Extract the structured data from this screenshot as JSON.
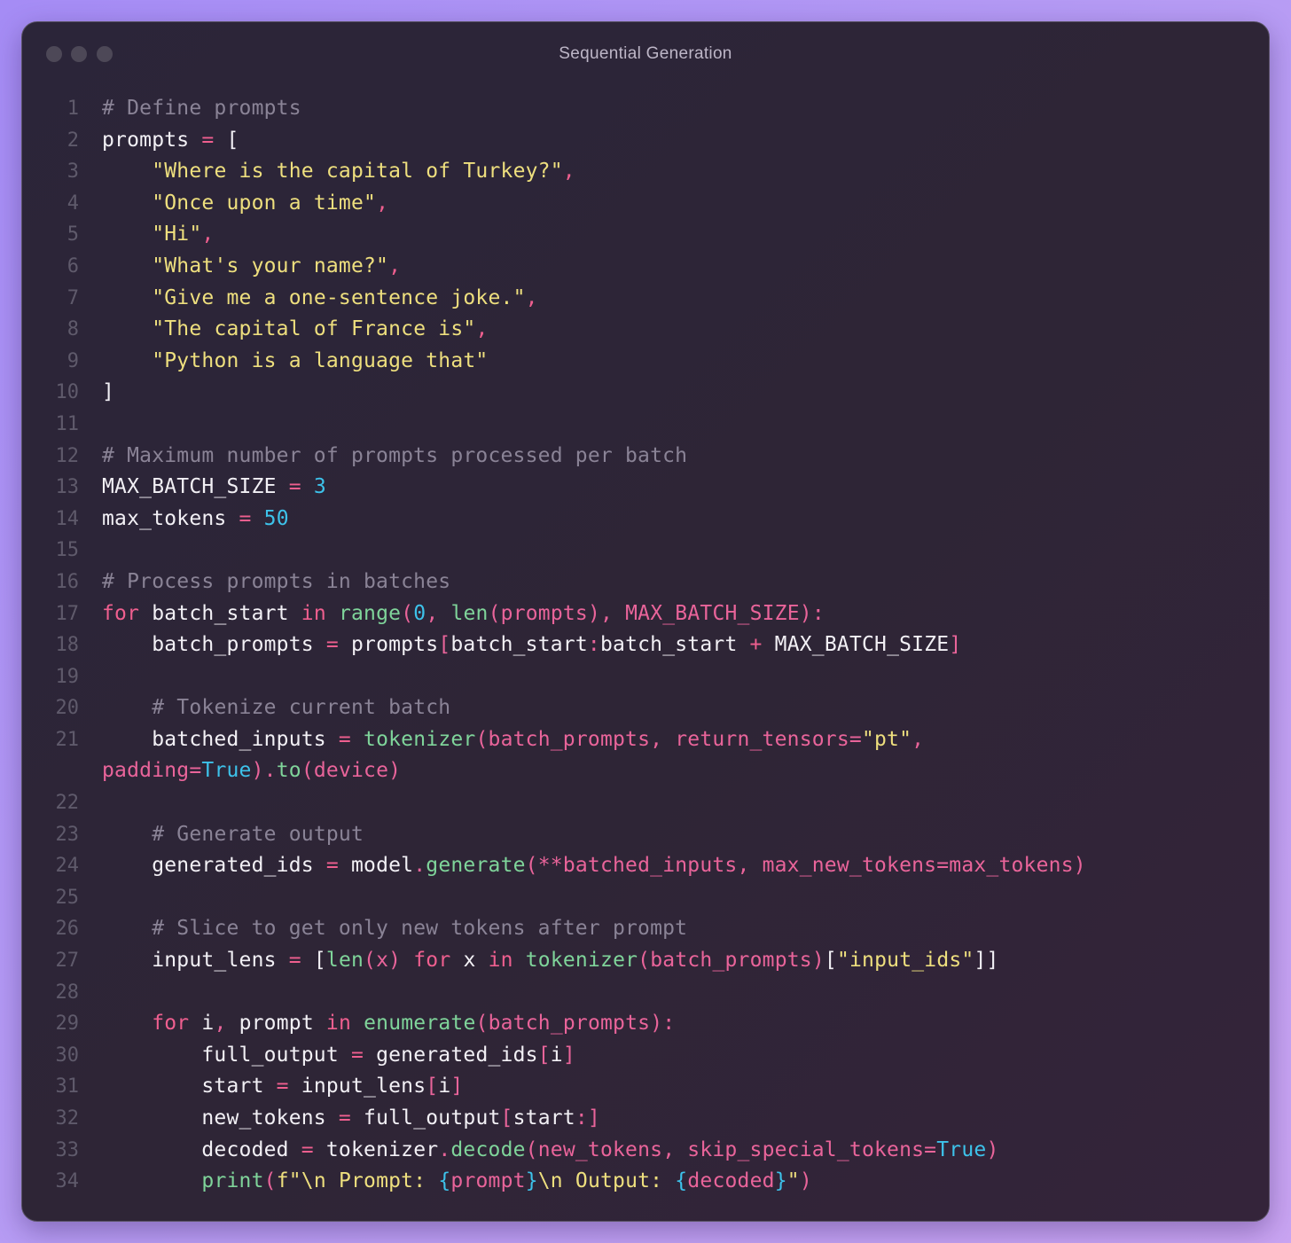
{
  "window": {
    "title": "Sequential Generation"
  },
  "code_lines": [
    {
      "n": "1",
      "t": [
        [
          "c",
          "# Define prompts"
        ]
      ]
    },
    {
      "n": "2",
      "t": [
        [
          "v",
          "prompts "
        ],
        [
          "k",
          "="
        ],
        [
          "v",
          " ["
        ]
      ]
    },
    {
      "n": "3",
      "t": [
        [
          "v",
          "    "
        ],
        [
          "s",
          "\"Where is the capital of Turkey?\""
        ],
        [
          "k",
          ","
        ]
      ]
    },
    {
      "n": "4",
      "t": [
        [
          "v",
          "    "
        ],
        [
          "s",
          "\"Once upon a time\""
        ],
        [
          "k",
          ","
        ]
      ]
    },
    {
      "n": "5",
      "t": [
        [
          "v",
          "    "
        ],
        [
          "s",
          "\"Hi\""
        ],
        [
          "k",
          ","
        ]
      ]
    },
    {
      "n": "6",
      "t": [
        [
          "v",
          "    "
        ],
        [
          "s",
          "\"What's your name?\""
        ],
        [
          "k",
          ","
        ]
      ]
    },
    {
      "n": "7",
      "t": [
        [
          "v",
          "    "
        ],
        [
          "s",
          "\"Give me a one-sentence joke.\""
        ],
        [
          "k",
          ","
        ]
      ]
    },
    {
      "n": "8",
      "t": [
        [
          "v",
          "    "
        ],
        [
          "s",
          "\"The capital of France is\""
        ],
        [
          "k",
          ","
        ]
      ]
    },
    {
      "n": "9",
      "t": [
        [
          "v",
          "    "
        ],
        [
          "s",
          "\"Python is a language that\""
        ]
      ]
    },
    {
      "n": "10",
      "t": [
        [
          "v",
          "]"
        ]
      ]
    },
    {
      "n": "11",
      "t": []
    },
    {
      "n": "12",
      "t": [
        [
          "c",
          "# Maximum number of prompts processed per batch"
        ]
      ]
    },
    {
      "n": "13",
      "t": [
        [
          "v",
          "MAX_BATCH_SIZE "
        ],
        [
          "k",
          "="
        ],
        [
          "v",
          " "
        ],
        [
          "n",
          "3"
        ]
      ]
    },
    {
      "n": "14",
      "t": [
        [
          "v",
          "max_tokens "
        ],
        [
          "k",
          "="
        ],
        [
          "v",
          " "
        ],
        [
          "n",
          "50"
        ]
      ]
    },
    {
      "n": "15",
      "t": []
    },
    {
      "n": "16",
      "t": [
        [
          "c",
          "# Process prompts in batches"
        ]
      ]
    },
    {
      "n": "17",
      "t": [
        [
          "k",
          "for"
        ],
        [
          "v",
          " batch_start "
        ],
        [
          "k",
          "in"
        ],
        [
          "v",
          " "
        ],
        [
          "f",
          "range"
        ],
        [
          "pl",
          "("
        ],
        [
          "n",
          "0"
        ],
        [
          "pl",
          ", "
        ],
        [
          "f",
          "len"
        ],
        [
          "pl",
          "(prompts), MAX_BATCH_SIZE):"
        ]
      ]
    },
    {
      "n": "18",
      "t": [
        [
          "v",
          "    batch_prompts "
        ],
        [
          "k",
          "="
        ],
        [
          "v",
          " prompts"
        ],
        [
          "pl",
          "["
        ],
        [
          "v",
          "batch_start"
        ],
        [
          "pl",
          ":"
        ],
        [
          "v",
          "batch_start "
        ],
        [
          "k",
          "+"
        ],
        [
          "v",
          " MAX_BATCH_SIZE"
        ],
        [
          "pl",
          "]"
        ]
      ]
    },
    {
      "n": "19",
      "t": []
    },
    {
      "n": "20",
      "t": [
        [
          "v",
          "    "
        ],
        [
          "c",
          "# Tokenize current batch"
        ]
      ]
    },
    {
      "n": "21",
      "t": [
        [
          "v",
          "    batched_inputs "
        ],
        [
          "k",
          "="
        ],
        [
          "v",
          " "
        ],
        [
          "f",
          "tokenizer"
        ],
        [
          "pl",
          "(batch_prompts, return_tensors="
        ],
        [
          "s",
          "\"pt\""
        ],
        [
          "pl",
          ","
        ]
      ]
    },
    {
      "n": "",
      "t": [
        [
          "pl",
          "padding="
        ],
        [
          "n",
          "True"
        ],
        [
          "pl",
          ")."
        ],
        [
          "f",
          "to"
        ],
        [
          "pl",
          "(device)"
        ]
      ]
    },
    {
      "n": "22",
      "t": []
    },
    {
      "n": "23",
      "t": [
        [
          "v",
          "    "
        ],
        [
          "c",
          "# Generate output"
        ]
      ]
    },
    {
      "n": "24",
      "t": [
        [
          "v",
          "    generated_ids "
        ],
        [
          "k",
          "="
        ],
        [
          "v",
          " model"
        ],
        [
          "pl",
          "."
        ],
        [
          "f",
          "generate"
        ],
        [
          "pl",
          "(**batched_inputs, max_new_tokens=max_tokens)"
        ]
      ]
    },
    {
      "n": "25",
      "t": []
    },
    {
      "n": "26",
      "t": [
        [
          "v",
          "    "
        ],
        [
          "c",
          "# Slice to get only new tokens after prompt"
        ]
      ]
    },
    {
      "n": "27",
      "t": [
        [
          "v",
          "    input_lens "
        ],
        [
          "k",
          "="
        ],
        [
          "v",
          " ["
        ],
        [
          "f",
          "len"
        ],
        [
          "pl",
          "(x) "
        ],
        [
          "k",
          "for"
        ],
        [
          "v",
          " x "
        ],
        [
          "k",
          "in"
        ],
        [
          "v",
          " "
        ],
        [
          "f",
          "tokenizer"
        ],
        [
          "pl",
          "(batch_prompts)"
        ],
        [
          "v",
          "["
        ],
        [
          "s",
          "\"input_ids\""
        ],
        [
          "v",
          "]]"
        ]
      ]
    },
    {
      "n": "28",
      "t": []
    },
    {
      "n": "29",
      "t": [
        [
          "v",
          "    "
        ],
        [
          "k",
          "for"
        ],
        [
          "v",
          " i"
        ],
        [
          "pl",
          ","
        ],
        [
          "v",
          " prompt "
        ],
        [
          "k",
          "in"
        ],
        [
          "v",
          " "
        ],
        [
          "f",
          "enumerate"
        ],
        [
          "pl",
          "(batch_prompts):"
        ]
      ]
    },
    {
      "n": "30",
      "t": [
        [
          "v",
          "        full_output "
        ],
        [
          "k",
          "="
        ],
        [
          "v",
          " generated_ids"
        ],
        [
          "pl",
          "["
        ],
        [
          "v",
          "i"
        ],
        [
          "pl",
          "]"
        ]
      ]
    },
    {
      "n": "31",
      "t": [
        [
          "v",
          "        start "
        ],
        [
          "k",
          "="
        ],
        [
          "v",
          " input_lens"
        ],
        [
          "pl",
          "["
        ],
        [
          "v",
          "i"
        ],
        [
          "pl",
          "]"
        ]
      ]
    },
    {
      "n": "32",
      "t": [
        [
          "v",
          "        new_tokens "
        ],
        [
          "k",
          "="
        ],
        [
          "v",
          " full_output"
        ],
        [
          "pl",
          "["
        ],
        [
          "v",
          "start"
        ],
        [
          "pl",
          ":]"
        ]
      ]
    },
    {
      "n": "33",
      "t": [
        [
          "v",
          "        decoded "
        ],
        [
          "k",
          "="
        ],
        [
          "v",
          " tokenizer"
        ],
        [
          "pl",
          "."
        ],
        [
          "f",
          "decode"
        ],
        [
          "pl",
          "(new_tokens, skip_special_tokens="
        ],
        [
          "n",
          "True"
        ],
        [
          "pl",
          ")"
        ]
      ]
    },
    {
      "n": "34",
      "t": [
        [
          "v",
          "        "
        ],
        [
          "f",
          "print"
        ],
        [
          "pl",
          "("
        ],
        [
          "s",
          "f\"\\n Prompt: "
        ],
        [
          "n",
          "{"
        ],
        [
          "pl",
          "prompt"
        ],
        [
          "n",
          "}"
        ],
        [
          "s",
          "\\n Output: "
        ],
        [
          "n",
          "{"
        ],
        [
          "pl",
          "decoded"
        ],
        [
          "n",
          "}"
        ],
        [
          "s",
          "\""
        ],
        [
          "pl",
          ")"
        ]
      ]
    }
  ]
}
